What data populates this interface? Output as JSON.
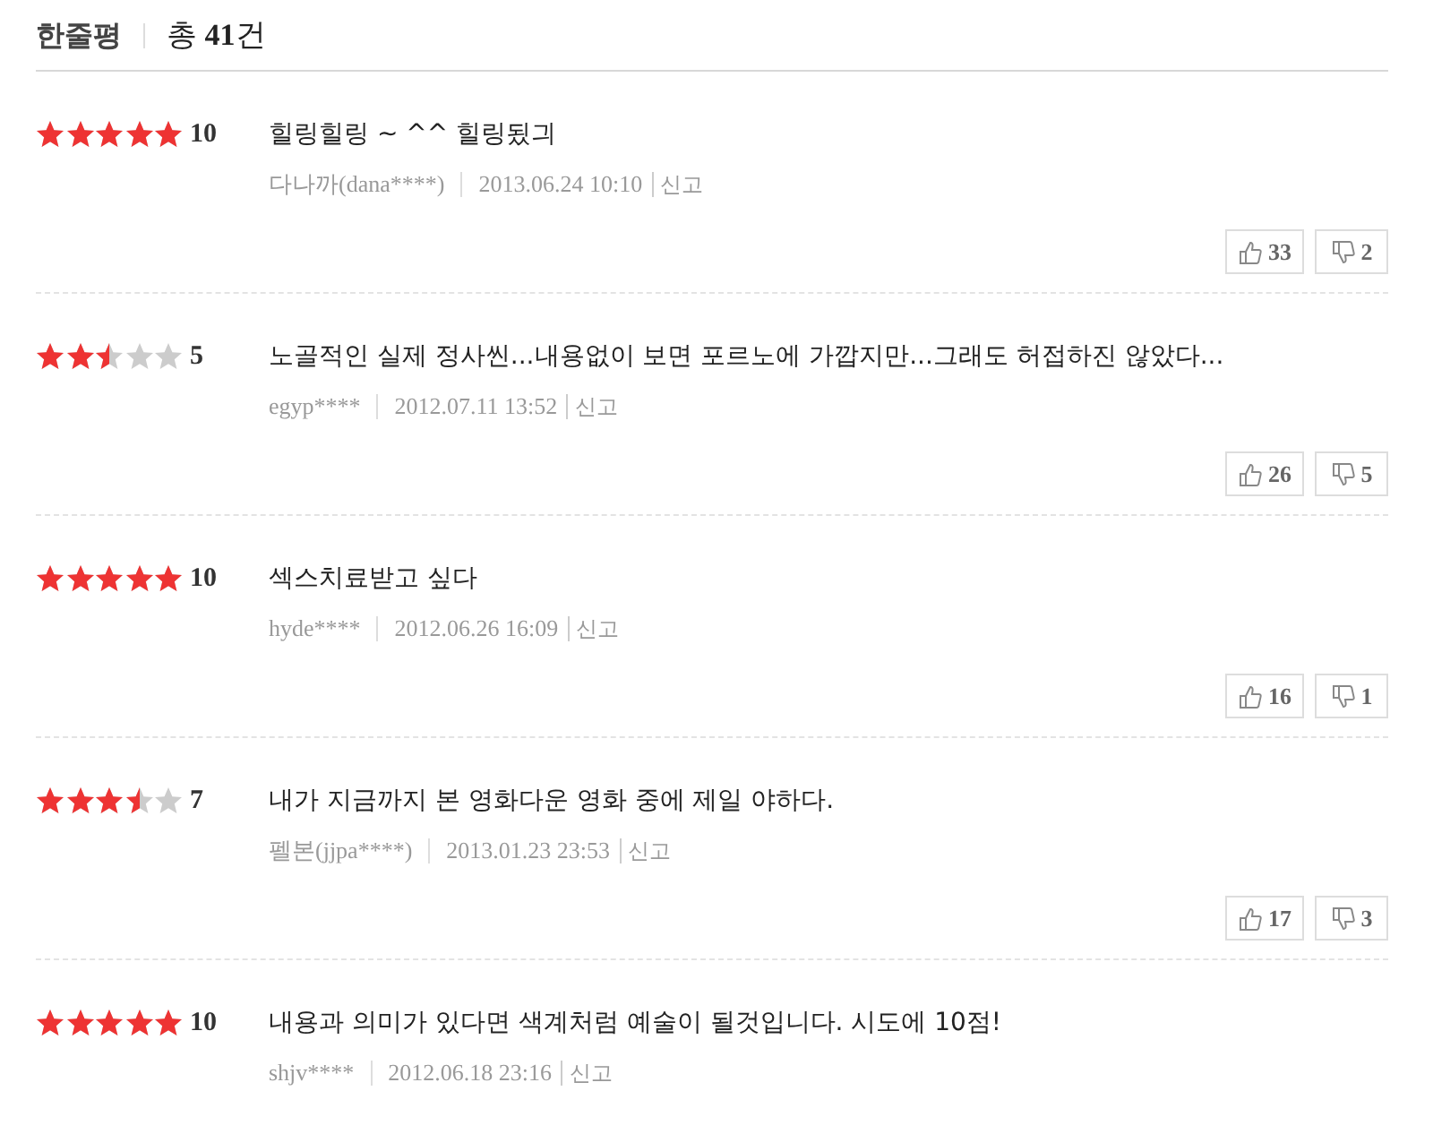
{
  "header": {
    "title": "한줄평",
    "count_prefix": "총",
    "count": "41",
    "count_suffix": "건"
  },
  "reviews": [
    {
      "stars": 5,
      "score": "10",
      "text": "힐링힐링 ~ ^^ 힐링됬긔",
      "author": "다나까(dana****)",
      "date": "2013.06.24 10:10",
      "report": "신고",
      "likes": "33",
      "dislikes": "2"
    },
    {
      "stars": 2.5,
      "score": "5",
      "text": "노골적인 실제 정사씬...내용없이 보면 포르노에 가깝지만...그래도 허접하진 않았다...",
      "author": "egyp****",
      "date": "2012.07.11 13:52",
      "report": "신고",
      "likes": "26",
      "dislikes": "5"
    },
    {
      "stars": 5,
      "score": "10",
      "text": "섹스치료받고 싶다",
      "author": "hyde****",
      "date": "2012.06.26 16:09",
      "report": "신고",
      "likes": "16",
      "dislikes": "1"
    },
    {
      "stars": 3.5,
      "score": "7",
      "text": "내가 지금까지 본 영화다운 영화 중에 제일 야하다.",
      "author": "펠본(jjpa****)",
      "date": "2013.01.23 23:53",
      "report": "신고",
      "likes": "17",
      "dislikes": "3"
    },
    {
      "stars": 5,
      "score": "10",
      "text": "내용과 의미가 있다면 색계처럼 예술이 될것입니다. 시도에 10점!",
      "author": "shjv****",
      "date": "2012.06.18 23:16",
      "report": "신고"
    }
  ]
}
